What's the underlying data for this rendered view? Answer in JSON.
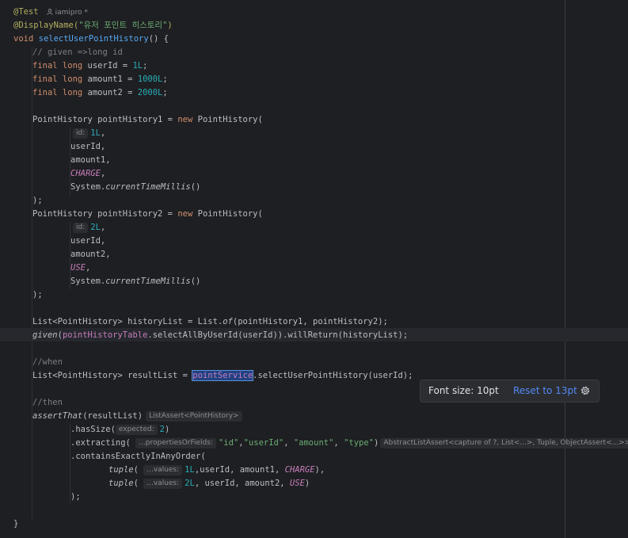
{
  "editor": {
    "annotation_test": "@Test",
    "author": "iamipro *",
    "display_name_ann": "@DisplayName(",
    "display_name_str": "\"유저 포인트 히스토리\"",
    "display_name_close": ")",
    "method_kw": "void",
    "method_name": "selectUserPointHistory",
    "method_rest": "() {",
    "comment_given": "// given =>long id",
    "final_kw": "final long",
    "userId_decl": " userId = ",
    "userId_val": "1L",
    "amount1_decl": " amount1 = ",
    "amount1_val": "1000L",
    "amount2_decl": " amount2 = ",
    "amount2_val": "2000L",
    "semi": ";",
    "ph1_decl": "PointHistory pointHistory1 = ",
    "new_kw": "new",
    "ph_ctor": " PointHistory(",
    "hint_id": "id:",
    "ph1_id": "1L",
    "comma": ",",
    "arg_userId": "userId,",
    "arg_amount1": "amount1,",
    "arg_amount2": "amount2,",
    "const_charge": "CHARGE",
    "const_use": "USE",
    "sys_prefix": "System.",
    "sys_method": "currentTimeMillis",
    "sys_suffix": "()",
    "close_paren": ");",
    "ph2_decl": "PointHistory pointHistory2 = ",
    "ph2_id": "2L",
    "list_decl": "List<PointHistory> historyList = List.",
    "list_of": "of",
    "list_args": "(pointHistory1, pointHistory2);",
    "given_fn": "given",
    "given_open": "(",
    "given_table": "pointHistoryTable",
    "given_rest": ".selectAllByUserId(userId)).willReturn(historyList);",
    "comment_when": "//when",
    "result_decl": "List<PointHistory> resultList = ",
    "result_service": "pointService",
    "result_rest": ".selectUserPointHistory(userId);",
    "comment_then": "//then",
    "assert_fn": "assertThat",
    "assert_args": "(resultList)",
    "hint_listassert": "ListAssert<PointHistory>",
    "hassize_pre": ".hasSize(",
    "hint_expected": "expected:",
    "hassize_val": "2",
    "hassize_close": ")",
    "extracting_pre": ".extracting(",
    "hint_props": "...propertiesOrFields:",
    "ext_s1": "\"id\"",
    "ext_s2": "\"userId\"",
    "ext_s3": "\"amount\"",
    "ext_s4": "\"type\"",
    "ext_sep": ",",
    "ext_sep_sp": ", ",
    "ext_close": ")",
    "hint_abstract": "AbstractListAssert<capture of ?, List<...>, Tuple, ObjectAssert<...>>",
    "contains_line": ".containsExactlyInAnyOrder(",
    "tuple_fn": "tuple",
    "tuple_open": "(",
    "hint_values": "...values:",
    "t1_id": "1L",
    "t1_rest": ",userId, amount1, ",
    "t1_close": "),",
    "t2_id": "2L",
    "t2_rest": ", userId, amount2, ",
    "t2_close": ")",
    "close_stmt": ");",
    "close_brace": "}"
  },
  "popup": {
    "font_size_label": "Font size: 10pt",
    "reset_label": "Reset to 13pt",
    "settings_icon": "gear-icon"
  },
  "colors": {
    "background": "#1e1f22",
    "keyword": "#cf8e6d",
    "method": "#56a8f5",
    "string": "#6aab73",
    "number": "#2aacb8",
    "comment": "#7a7e85",
    "field": "#c77dbb",
    "annotation": "#b3ae60",
    "link": "#548af7"
  }
}
